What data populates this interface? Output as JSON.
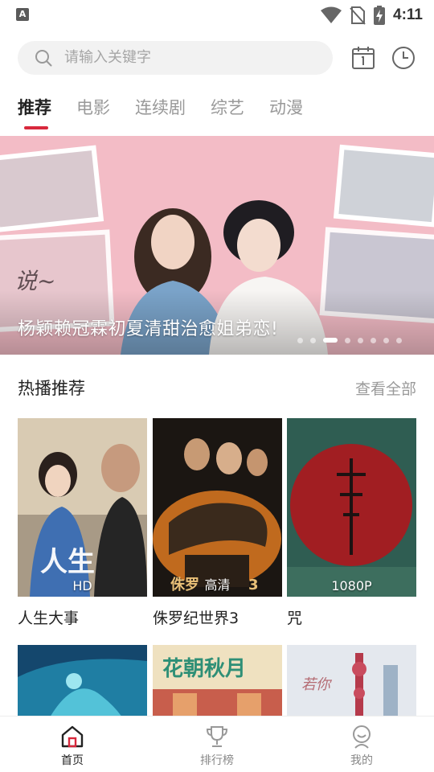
{
  "status_bar": {
    "left_badge": "A",
    "time": "4:11",
    "icons": [
      "wifi-icon",
      "no-sim-icon",
      "battery-charging-icon"
    ]
  },
  "search": {
    "placeholder": "请输入关键字",
    "icon": "search-icon"
  },
  "header_actions": {
    "calendar_icon": "calendar-icon",
    "history_icon": "clock-icon"
  },
  "tabs": [
    {
      "label": "推荐",
      "active": true
    },
    {
      "label": "电影",
      "active": false
    },
    {
      "label": "连续剧",
      "active": false
    },
    {
      "label": "综艺",
      "active": false
    },
    {
      "label": "动漫",
      "active": false
    }
  ],
  "banner": {
    "caption": "杨颖赖冠霖初夏清甜治愈姐弟恋!",
    "dot_count": 8,
    "active_dot": 2
  },
  "section": {
    "title": "热播推荐",
    "see_all": "查看全部"
  },
  "cards": [
    {
      "title": "人生大事",
      "badge": "HD"
    },
    {
      "title": "侏罗纪世界3",
      "badge": "高清"
    },
    {
      "title": "咒",
      "badge": "1080P"
    }
  ],
  "bottom_nav": [
    {
      "label": "首页",
      "icon": "home-icon",
      "active": true
    },
    {
      "label": "排行榜",
      "icon": "trophy-icon",
      "active": false
    },
    {
      "label": "我的",
      "icon": "profile-icon",
      "active": false
    }
  ],
  "colors": {
    "accent": "#d8283c",
    "tab_inactive": "#999999",
    "search_bg": "#f2f2f2"
  }
}
